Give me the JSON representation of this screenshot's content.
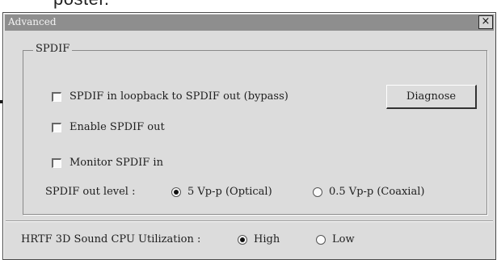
{
  "background": {
    "text": "poster."
  },
  "window": {
    "title": "Advanced",
    "close_glyph": "×"
  },
  "spdif": {
    "group_label": "SPDIF",
    "checkboxes": [
      {
        "label": "SPDIF in loopback to SPDIF out (bypass)",
        "checked": false
      },
      {
        "label": "Enable SPDIF out",
        "checked": false
      },
      {
        "label": "Monitor SPDIF in",
        "checked": false
      }
    ],
    "diagnose_label": "Diagnose",
    "out_level_label": "SPDIF out level :",
    "out_level_options": [
      {
        "label": "5 Vp-p (Optical)",
        "selected": true
      },
      {
        "label": "0.5 Vp-p (Coaxial)",
        "selected": false
      }
    ]
  },
  "hrtf": {
    "label": "HRTF 3D Sound CPU Utilization :",
    "options": [
      {
        "label": "High",
        "selected": true
      },
      {
        "label": "Low",
        "selected": false
      }
    ]
  }
}
